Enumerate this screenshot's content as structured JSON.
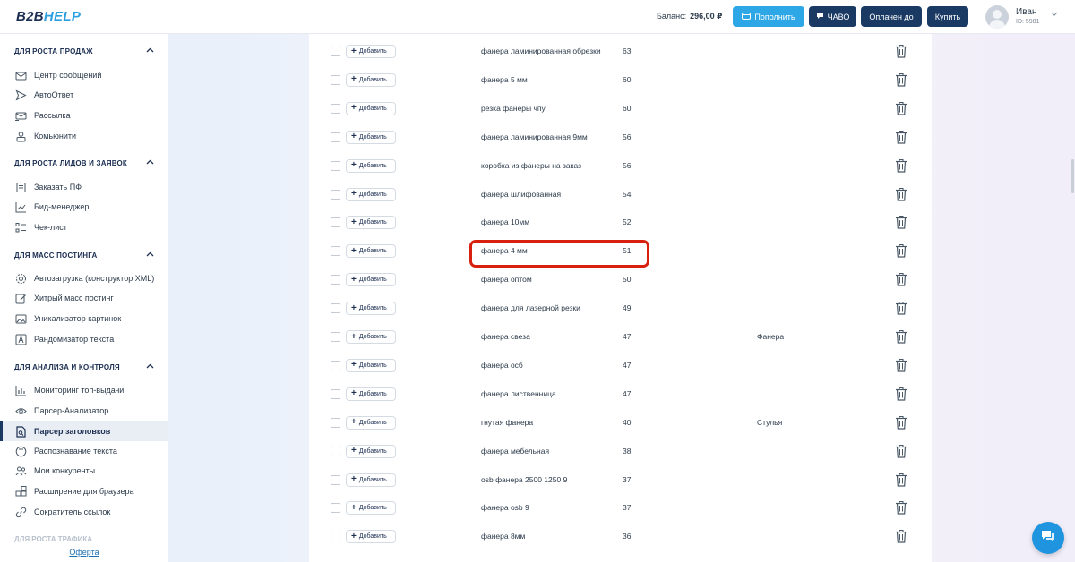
{
  "header": {
    "logo_part1": "B2B",
    "logo_part2": "HELP",
    "balance_label": "Баланс:",
    "balance_value": "296,00 ₽",
    "topup_label": "Пополнить",
    "faq_label": "ЧАВО",
    "paid_label": "Оплачен до",
    "buy_label": "Купить",
    "user_name": "Иван",
    "user_id": "ID: 5981"
  },
  "sidebar": {
    "sections": [
      {
        "title": "ДЛЯ РОСТА ПРОДАЖ",
        "items": [
          {
            "label": "Центр сообщений",
            "icon": "mail-icon"
          },
          {
            "label": "АвтоОтвет",
            "icon": "send-icon"
          },
          {
            "label": "Рассылка",
            "icon": "broadcast-icon"
          },
          {
            "label": "Комьюнити",
            "icon": "community-icon"
          }
        ]
      },
      {
        "title": "ДЛЯ РОСТА ЛИДОВ И ЗАЯВОК",
        "items": [
          {
            "label": "Заказать ПФ",
            "icon": "order-icon"
          },
          {
            "label": "Бид-менеджер",
            "icon": "chart-line-icon"
          },
          {
            "label": "Чек-лист",
            "icon": "checklist-icon"
          }
        ]
      },
      {
        "title": "ДЛЯ МАСС ПОСТИНГА",
        "items": [
          {
            "label": "Автозагрузка (конструктор XML)",
            "icon": "gear-icon"
          },
          {
            "label": "Хитрый масс постинг",
            "icon": "edit-icon"
          },
          {
            "label": "Уникализатор картинок",
            "icon": "image-icon"
          },
          {
            "label": "Рандомизатор текста",
            "icon": "text-random-icon"
          }
        ]
      },
      {
        "title": "ДЛЯ АНАЛИЗА И КОНТРОЛЯ",
        "items": [
          {
            "label": "Мониторинг топ-выдачи",
            "icon": "monitoring-icon"
          },
          {
            "label": "Парсер-Анализатор",
            "icon": "eye-icon"
          },
          {
            "label": "Парсер заголовков",
            "icon": "document-search-icon",
            "active": true
          },
          {
            "label": "Распознавание текста",
            "icon": "text-recognition-icon"
          },
          {
            "label": "Мои конкуренты",
            "icon": "competitors-icon"
          },
          {
            "label": "Расширение для браузера",
            "icon": "extension-icon"
          },
          {
            "label": "Сократитель ссылок",
            "icon": "link-icon"
          }
        ]
      }
    ],
    "cut_section_title": "ДЛЯ РОСТА ТРАФИКА",
    "offer_link": "Оферта"
  },
  "table": {
    "add_label": "Добавить",
    "rows": [
      {
        "phrase": "фанера ламинированная обрезки",
        "freq": "63",
        "cat": ""
      },
      {
        "phrase": "фанера 5 мм",
        "freq": "60",
        "cat": ""
      },
      {
        "phrase": "резка фанеры чпу",
        "freq": "60",
        "cat": ""
      },
      {
        "phrase": "фанера ламинированная 9мм",
        "freq": "56",
        "cat": ""
      },
      {
        "phrase": "коробка из фанеры на заказ",
        "freq": "56",
        "cat": ""
      },
      {
        "phrase": "фанера шлифованная",
        "freq": "54",
        "cat": ""
      },
      {
        "phrase": "фанера 10мм",
        "freq": "52",
        "cat": ""
      },
      {
        "phrase": "фанера 4 мм",
        "freq": "51",
        "cat": ""
      },
      {
        "phrase": "фанера оптом",
        "freq": "50",
        "cat": ""
      },
      {
        "phrase": "фанера для лазерной резки",
        "freq": "49",
        "cat": ""
      },
      {
        "phrase": "фанера свеза",
        "freq": "47",
        "cat": "Фанера"
      },
      {
        "phrase": "фанера осб",
        "freq": "47",
        "cat": ""
      },
      {
        "phrase": "фанера лиственница",
        "freq": "47",
        "cat": ""
      },
      {
        "phrase": "гнутая фанера",
        "freq": "40",
        "cat": "Стулья"
      },
      {
        "phrase": "фанера мебельная",
        "freq": "38",
        "cat": ""
      },
      {
        "phrase": "osb фанера 2500 1250 9",
        "freq": "37",
        "cat": ""
      },
      {
        "phrase": "фанера osb 9",
        "freq": "37",
        "cat": ""
      },
      {
        "phrase": "фанера 8мм",
        "freq": "36",
        "cat": ""
      }
    ],
    "highlighted_row": "фанера 4 мм"
  },
  "colors": {
    "brand_dark": "#1a3a63",
    "accent_blue": "#2ea7e6",
    "highlight_red": "#d8200f"
  }
}
